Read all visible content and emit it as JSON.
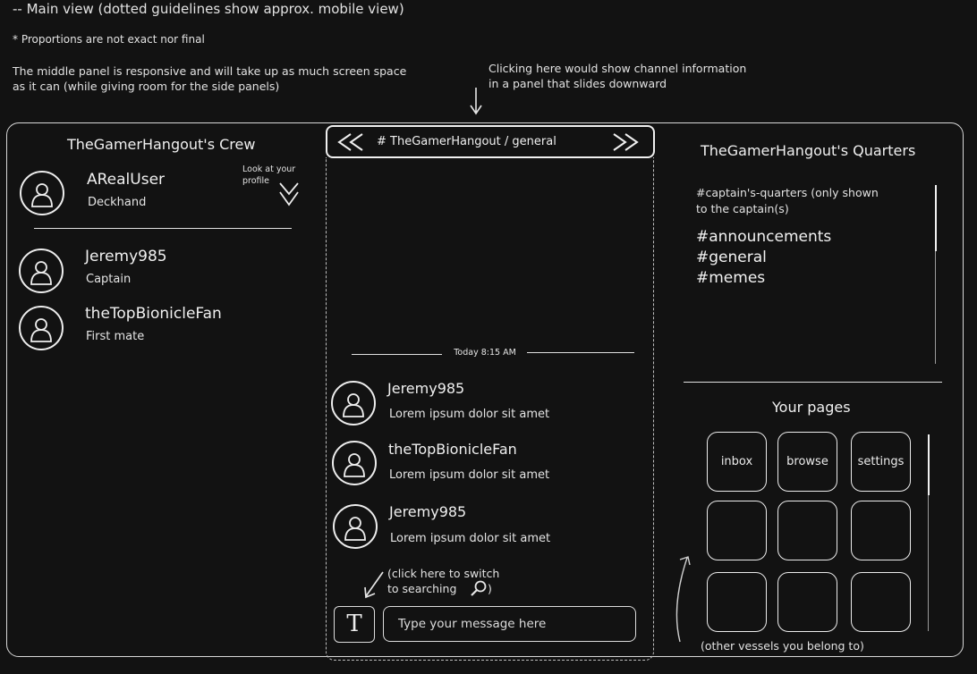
{
  "notes": {
    "title": "-- Main view (dotted guidelines show approx. mobile view)",
    "proportions": "* Proportions are not exact nor final",
    "responsive_line1": "The middle panel is responsive and will take up as much screen space",
    "responsive_line2": "as it can (while giving room for the side panels)",
    "channel_info_line1": "Clicking here would show channel information",
    "channel_info_line2": "in a panel that slides downward",
    "profile_line1": "Look at your",
    "profile_line2": "profile",
    "search_line1": "(click here to switch",
    "search_line2": "to searching",
    "search_close": ")",
    "vessels": "(other vessels you belong to)"
  },
  "crew": {
    "title": "TheGamerHangout's Crew",
    "current_user": {
      "name": "ARealUser",
      "role": "Deckhand"
    },
    "members": [
      {
        "name": "Jeremy985",
        "role": "Captain"
      },
      {
        "name": "theTopBionicleFan",
        "role": "First mate"
      }
    ]
  },
  "channel": {
    "header": "# TheGamerHangout / general",
    "prev_icon": "double-chevron-left",
    "next_icon": "double-chevron-right",
    "divider_time": "Today 8:15 AM",
    "messages": [
      {
        "author": "Jeremy985",
        "text": "Lorem ipsum dolor sit amet"
      },
      {
        "author": "theTopBionicleFan",
        "text": "Lorem ipsum dolor sit amet"
      },
      {
        "author": "Jeremy985",
        "text": "Lorem ipsum dolor sit amet"
      }
    ],
    "mode_button": "T",
    "input_placeholder": "Type your message here"
  },
  "quarters": {
    "title": "TheGamerHangout's Quarters",
    "captain_channel_line1": "#captain's-quarters (only shown",
    "captain_channel_line2": "to the captain(s)",
    "channels": [
      "#announcements",
      "#general",
      "#memes"
    ]
  },
  "pages": {
    "title": "Your pages",
    "tiles": [
      "inbox",
      "browse",
      "settings"
    ]
  },
  "colors": {
    "background": "#121212",
    "foreground": "#e9e9e9"
  }
}
